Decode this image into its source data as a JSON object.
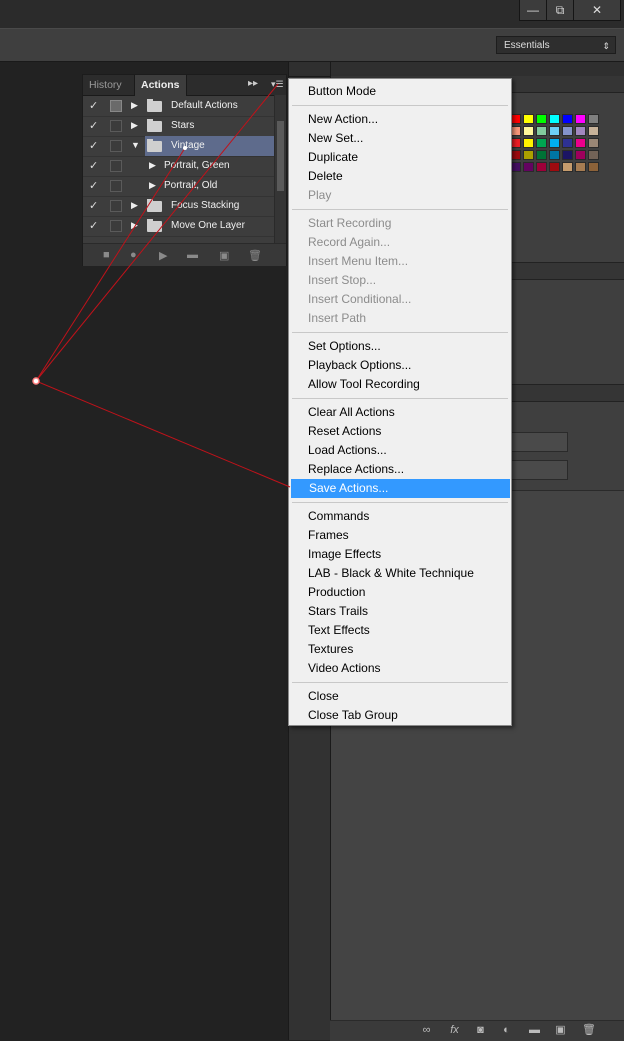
{
  "window": {
    "minimize": "—",
    "restore": "⧉",
    "close": "✕"
  },
  "workspace": {
    "value": "Essentials"
  },
  "panel": {
    "tabs": [
      "History",
      "Actions"
    ],
    "actions": [
      {
        "label": "Default Actions",
        "checked": true,
        "dialog": true,
        "expanded": false,
        "type": "set"
      },
      {
        "label": "Stars",
        "checked": true,
        "dialog": false,
        "expanded": false,
        "type": "set"
      },
      {
        "label": "Vintage",
        "checked": true,
        "dialog": false,
        "expanded": true,
        "type": "set",
        "selected": true
      },
      {
        "label": "Portrait, Green",
        "checked": true,
        "dialog": false,
        "expanded": false,
        "type": "action"
      },
      {
        "label": "Portrait, Old",
        "checked": true,
        "dialog": false,
        "expanded": false,
        "type": "action"
      },
      {
        "label": "Focus Stacking",
        "checked": true,
        "dialog": false,
        "expanded": false,
        "type": "set"
      },
      {
        "label": "Move One Layer",
        "checked": true,
        "dialog": false,
        "expanded": false,
        "type": "set"
      }
    ]
  },
  "menu": {
    "groups": [
      [
        {
          "label": "Button Mode"
        }
      ],
      [
        {
          "label": "New Action..."
        },
        {
          "label": "New Set..."
        },
        {
          "label": "Duplicate"
        },
        {
          "label": "Delete"
        },
        {
          "label": "Play",
          "disabled": true
        }
      ],
      [
        {
          "label": "Start Recording",
          "disabled": true
        },
        {
          "label": "Record Again...",
          "disabled": true
        },
        {
          "label": "Insert Menu Item...",
          "disabled": true
        },
        {
          "label": "Insert Stop...",
          "disabled": true
        },
        {
          "label": "Insert Conditional...",
          "disabled": true
        },
        {
          "label": "Insert Path",
          "disabled": true
        }
      ],
      [
        {
          "label": "Set Options..."
        },
        {
          "label": "Playback Options..."
        },
        {
          "label": "Allow Tool Recording"
        }
      ],
      [
        {
          "label": "Clear All Actions"
        },
        {
          "label": "Reset Actions"
        },
        {
          "label": "Load Actions..."
        },
        {
          "label": "Replace Actions..."
        },
        {
          "label": "Save Actions...",
          "highlighted": true
        }
      ],
      [
        {
          "label": "Commands"
        },
        {
          "label": "Frames"
        },
        {
          "label": "Image Effects"
        },
        {
          "label": "LAB - Black & White Technique"
        },
        {
          "label": "Production"
        },
        {
          "label": "Stars Trails"
        },
        {
          "label": "Text Effects"
        },
        {
          "label": "Textures"
        },
        {
          "label": "Video Actions"
        }
      ],
      [
        {
          "label": "Close"
        },
        {
          "label": "Close Tab Group"
        }
      ]
    ]
  },
  "colors": {
    "highlight": "#3399ff",
    "selection": "#5e6b8c",
    "annotation_line": "#c0121a",
    "swatches": [
      "#ff0000",
      "#ffff00",
      "#00ff00",
      "#00ffff",
      "#0000ff",
      "#ff00ff",
      "#7f7f7f",
      "#f7977a",
      "#fff79a",
      "#82ca9d",
      "#6dcff6",
      "#8493ca",
      "#a187be",
      "#c7b299",
      "#ed1c24",
      "#fff200",
      "#00a651",
      "#00aeef",
      "#2e3192",
      "#ec008c",
      "#998675",
      "#9e0b0f",
      "#aba000",
      "#007236",
      "#0076a3",
      "#1b1464",
      "#9e005d",
      "#736357",
      "#440e62",
      "#630460",
      "#9e0039",
      "#9e0b0f",
      "#c69c6d",
      "#a67c52",
      "#8c6239"
    ]
  }
}
